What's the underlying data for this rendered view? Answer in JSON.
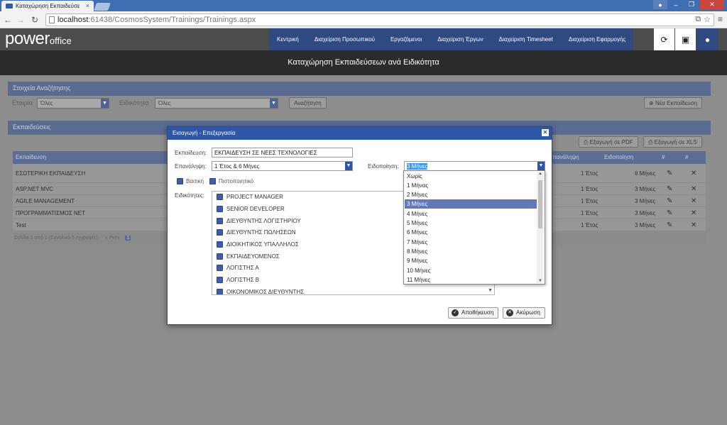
{
  "browser": {
    "tab_title": "Καταχώρηση Εκπαιδεύσε",
    "url_host": "localhost",
    "url_path": ":61438/CosmosSystem/Trainings/Trainings.aspx"
  },
  "app": {
    "logo_main": "power",
    "logo_sub": "office",
    "nav": [
      "Κεντρική",
      "Διαχείριση Προσωπικού",
      "Εργαζόμενοι",
      "Διαχείριση Έργων",
      "Διαχείριση Timesheet",
      "Διαχείριση Εφαρμογής"
    ],
    "page_title": "Καταχώρηση Εκπαιδεύσεων ανά Ειδικότητα"
  },
  "search": {
    "section_title": "Στοιχεία Αναζήτησης",
    "company_label": "Εταιρία",
    "company_value": "Όλες",
    "specialty_label": "Ειδικότητα",
    "specialty_value": "Όλες",
    "search_button": "Αναζήτηση",
    "new_button": "Νέα Εκπαίδευση"
  },
  "trainings": {
    "section_title": "Εκπαιδεύσεις",
    "export_pdf": "Εξαγωγή σε PDF",
    "export_xls": "Εξαγωγή σε XLS",
    "columns": [
      "Εκπαίδευση",
      "Επανάληψη",
      "Ειδοποίηση",
      "#",
      "#"
    ],
    "rows": [
      {
        "name": "ΕΣΩΤΕΡΙΚΗ ΕΚΠΑΙΔΕΥΣΗ",
        "repeat": "1 Έτος",
        "notify": "6 Μήνες"
      },
      {
        "name": "ASP.NET MVC",
        "repeat": "1 Έτος",
        "notify": "3 Μήνες"
      },
      {
        "name": "AGILE MANAGEMENT",
        "repeat": "1 Έτος",
        "notify": "3 Μήνες"
      },
      {
        "name": "ΠΡΟΓΡΑΜΜΑΤΙΣΜΟΣ NET",
        "repeat": "1 Έτος",
        "notify": "3 Μήνες"
      },
      {
        "name": "Test",
        "repeat": "1 Έτος",
        "notify": "3 Μήνες"
      }
    ],
    "pager_text": "Σελίδα 1 από 1 (Συνολικά 5 εγγραφές)",
    "pager_prev": "« Prev",
    "pager_page": "1"
  },
  "modal": {
    "title": "Εισαγωγή - Επεξεργασία",
    "training_label": "Εκπαίδευση:",
    "training_value": "ΕΚΠΑΙΔΕΥΣΗ ΣΕ ΝΕΕΣ ΤΕΧΝΟΛΟΓΙΕΣ",
    "repeat_label": "Επανάληψη:",
    "repeat_value": "1 Έτος & 6 Μήνες",
    "notify_label": "Ειδοποίηση:",
    "notify_value": "3 Μήνες",
    "basic_label": "Βασική",
    "certificate_label": "Πιστοποιητικό",
    "specialties_label": "Ειδικότητες:",
    "specialties": [
      "PROJECT MANAGER",
      "SENIOR DEVELOPER",
      "ΔΙΕΥΘΥΝΤΗΣ ΛΟΓΙΣΤΗΡΙΟΥ",
      "ΔΙΕΥΘΥΝΤΗΣ ΠΩΛΗΣΕΩΝ",
      "ΔΙΟΙΚΗΤΙΚΟΣ ΥΠΑΛΛΗΛΟΣ",
      "ΕΚΠΑΙΔΕΥΟΜΕΝΟΣ",
      "ΛΟΓΙΣΤΗΣ Α",
      "ΛΟΓΙΣΤΗΣ Β",
      "ΟΙΚΟΝΟΜΙΚΟΣ ΔΙΕΥΘΥΝΤΗΣ"
    ],
    "save_button": "Αποθήκευση",
    "cancel_button": "Ακύρωση"
  },
  "notify_dropdown": {
    "options": [
      "Χωρίς",
      "1 Μήνας",
      "2 Μήνες",
      "3 Μήνες",
      "4 Μήνες",
      "5 Μήνες",
      "6 Μήνες",
      "7 Μήνες",
      "8 Μήνες",
      "9 Μήνες",
      "10 Μήνες",
      "11 Μήνες"
    ],
    "selected": "3 Μήνες"
  }
}
